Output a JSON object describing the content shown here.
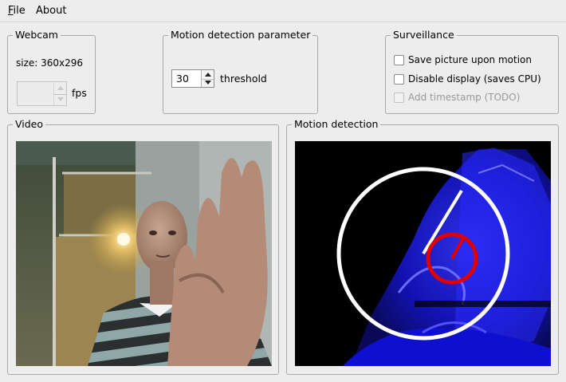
{
  "menu": {
    "file": "File",
    "about": "About"
  },
  "webcam": {
    "title": "Webcam",
    "size_label": "size: 360x296",
    "fps_value": "",
    "fps_unit": "fps"
  },
  "motion_param": {
    "title": "Motion detection parameter",
    "threshold_value": "30",
    "threshold_label": "threshold"
  },
  "surveillance": {
    "title": "Surveillance",
    "options": [
      {
        "label": "Save picture upon motion",
        "checked": false,
        "enabled": true
      },
      {
        "label": "Disable display (saves CPU)",
        "checked": false,
        "enabled": true
      },
      {
        "label": "Add timestamp (TODO)",
        "checked": false,
        "enabled": false
      }
    ]
  },
  "video": {
    "title": "Video"
  },
  "motion": {
    "title": "Motion detection"
  },
  "colors": {
    "window_bg": "#ededed",
    "motion_bg": "#000000",
    "motion_blue": "#1a1aff",
    "overlay_white": "#ffffff",
    "overlay_red": "#e00000"
  }
}
